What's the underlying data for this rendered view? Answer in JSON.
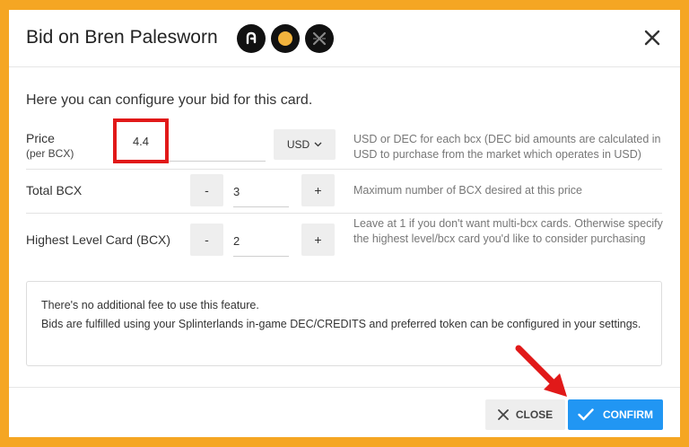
{
  "dialog": {
    "title": "Bid on Bren Palesworn",
    "intro": "Here you can configure your bid for this card."
  },
  "price": {
    "label": "Price",
    "sublabel": "(per BCX)",
    "value": "4.4",
    "currency": "USD",
    "help": "USD or DEC for each bcx (DEC bid amounts are calculated in USD to purchase from the market which operates in USD)"
  },
  "total_bcx": {
    "label": "Total BCX",
    "minus": "-",
    "value": "3",
    "plus": "+",
    "help": "Maximum number of BCX desired at this price"
  },
  "highest_level": {
    "label": "Highest Level Card (BCX)",
    "minus": "-",
    "value": "2",
    "plus": "+",
    "help": "Leave at 1 if you don't want multi-bcx cards. Otherwise specify the highest level/bcx card you'd like to consider purchasing"
  },
  "info": {
    "line1": "There's no additional fee to use this feature.",
    "line2": "Bids are fulfilled using your Splinterlands in-game DEC/CREDITS and preferred token can be configured in your settings."
  },
  "footer": {
    "close_label": "CLOSE",
    "confirm_label": "CONFIRM"
  },
  "colors": {
    "background": "#f5a623",
    "highlight": "#e11919",
    "confirm": "#2196f3"
  }
}
